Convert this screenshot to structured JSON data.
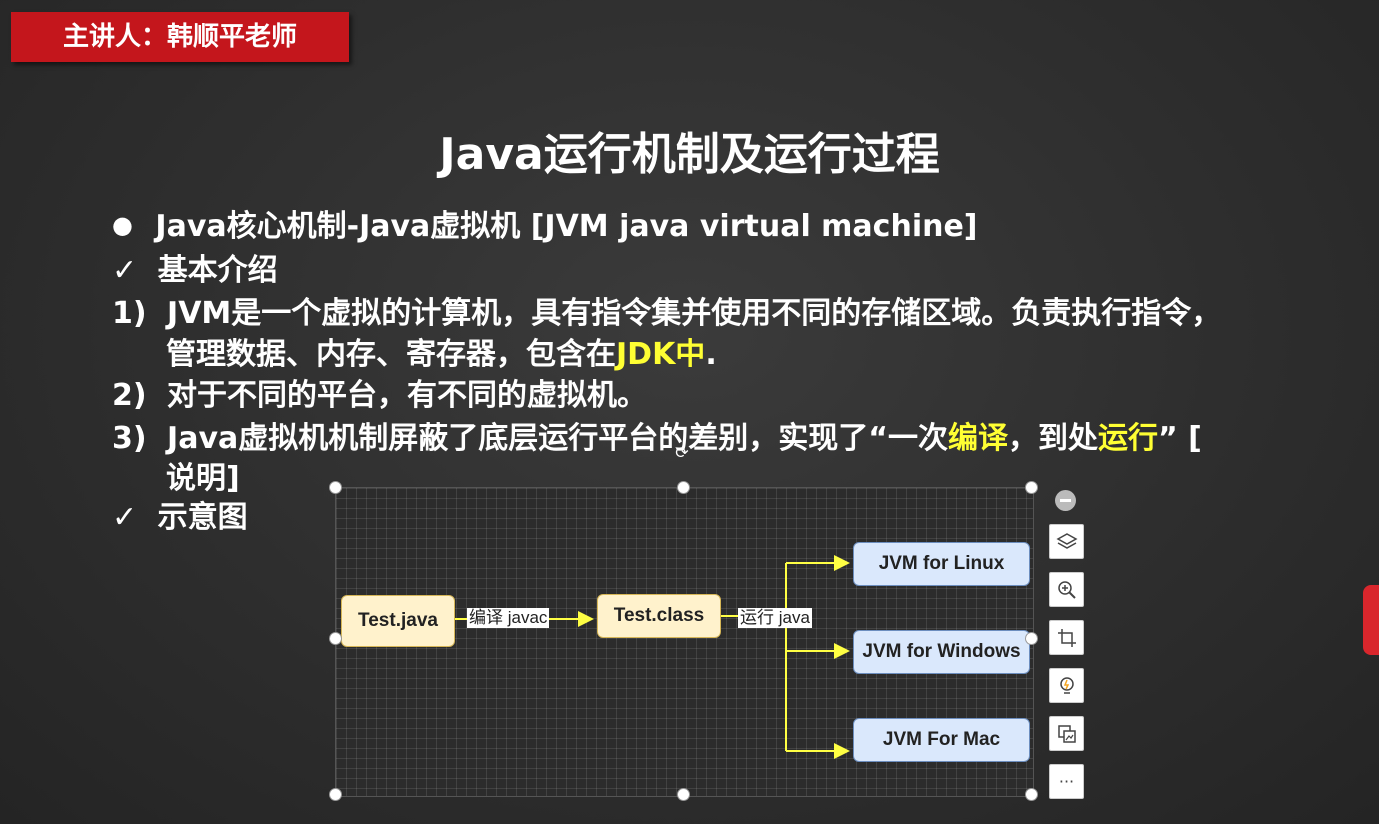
{
  "speaker": "主讲人：韩顺平老师",
  "title": "Java运行机制及运行过程",
  "bullet": {
    "symbol": "●",
    "text": "Java核心机制-Java虚拟机 [JVM java virtual machine]"
  },
  "intro": {
    "symbol": "✓",
    "text": "基本介绍"
  },
  "items": [
    {
      "num": "1)",
      "line1": "JVM是一个虚拟的计算机，具有指令集并使用不同的存储区域。负责执行指令，",
      "line2_pre": "管理数据、内存、寄存器，包含在",
      "line2_hl": "JDK中",
      "line2_post": "."
    },
    {
      "num": "2)",
      "line1": "对于不同的平台，有不同的虚拟机。"
    },
    {
      "num": "3)",
      "p1": "Java虚拟机机制屏蔽了底层运行平台的差别，实现了“一次",
      "h1": "编译",
      "p2": "，到处",
      "h2": "运行",
      "p3": "” [",
      "line2": "说明]"
    }
  ],
  "diagram_label": {
    "symbol": "✓",
    "text": "示意图"
  },
  "diagram": {
    "nodes": {
      "source": "Test.java",
      "class": "Test.class",
      "linux": "JVM for Linux",
      "windows": "JVM for Windows",
      "mac": "JVM For Mac"
    },
    "edges": {
      "compile": "编译 javac",
      "run": "运行 java"
    }
  },
  "toolbar": {
    "icons": [
      "minus-icon",
      "layers-icon",
      "zoom-in-icon",
      "crop-icon",
      "lightbulb-icon",
      "image-convert-icon",
      "more-icon"
    ],
    "more": "···"
  },
  "colors": {
    "highlight": "#ffff33",
    "speaker_bg": "#c4161c",
    "arrow": "#ffff44"
  }
}
